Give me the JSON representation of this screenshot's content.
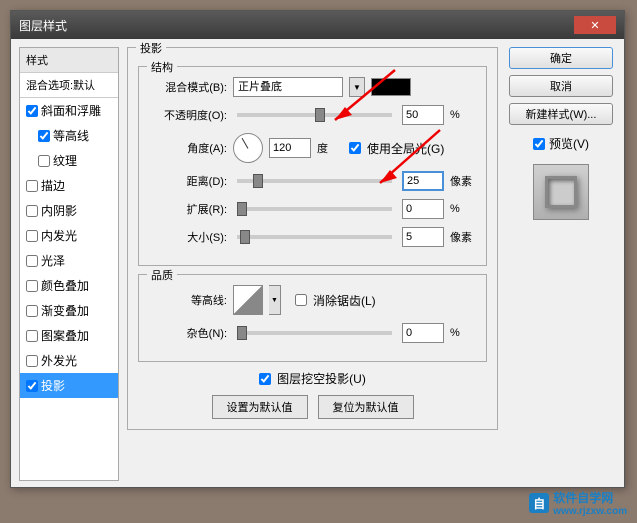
{
  "titlebar": {
    "title": "图层样式",
    "close": "✕"
  },
  "left": {
    "header": "样式",
    "subheader": "混合选项:默认",
    "items": [
      {
        "label": "斜面和浮雕",
        "checked": true,
        "indent": false
      },
      {
        "label": "等高线",
        "checked": true,
        "indent": true
      },
      {
        "label": "纹理",
        "checked": false,
        "indent": true
      },
      {
        "label": "描边",
        "checked": false,
        "indent": false
      },
      {
        "label": "内阴影",
        "checked": false,
        "indent": false
      },
      {
        "label": "内发光",
        "checked": false,
        "indent": false
      },
      {
        "label": "光泽",
        "checked": false,
        "indent": false
      },
      {
        "label": "颜色叠加",
        "checked": false,
        "indent": false
      },
      {
        "label": "渐变叠加",
        "checked": false,
        "indent": false
      },
      {
        "label": "图案叠加",
        "checked": false,
        "indent": false
      },
      {
        "label": "外发光",
        "checked": false,
        "indent": false
      },
      {
        "label": "投影",
        "checked": true,
        "indent": false,
        "selected": true
      }
    ]
  },
  "center": {
    "group_title": "投影",
    "structure": {
      "legend": "结构",
      "blend_label": "混合模式(B):",
      "blend_value": "正片叠底",
      "opacity_label": "不透明度(O):",
      "opacity_value": "50",
      "opacity_unit": "%",
      "angle_label": "角度(A):",
      "angle_value": "120",
      "angle_unit": "度",
      "global_light_label": "使用全局光(G)",
      "global_light_checked": true,
      "distance_label": "距离(D):",
      "distance_value": "25",
      "distance_unit": "像素",
      "spread_label": "扩展(R):",
      "spread_value": "0",
      "spread_unit": "%",
      "size_label": "大小(S):",
      "size_value": "5",
      "size_unit": "像素"
    },
    "quality": {
      "legend": "品质",
      "contour_label": "等高线:",
      "antialias_label": "消除锯齿(L)",
      "antialias_checked": false,
      "noise_label": "杂色(N):",
      "noise_value": "0",
      "noise_unit": "%"
    },
    "knockout_label": "图层挖空投影(U)",
    "knockout_checked": true,
    "btn_default": "设置为默认值",
    "btn_reset": "复位为默认值"
  },
  "right": {
    "ok": "确定",
    "cancel": "取消",
    "new_style": "新建样式(W)...",
    "preview_label": "预览(V)",
    "preview_checked": true
  },
  "watermark": {
    "text": "软件自学网",
    "url": "www.rjzxw.com"
  }
}
